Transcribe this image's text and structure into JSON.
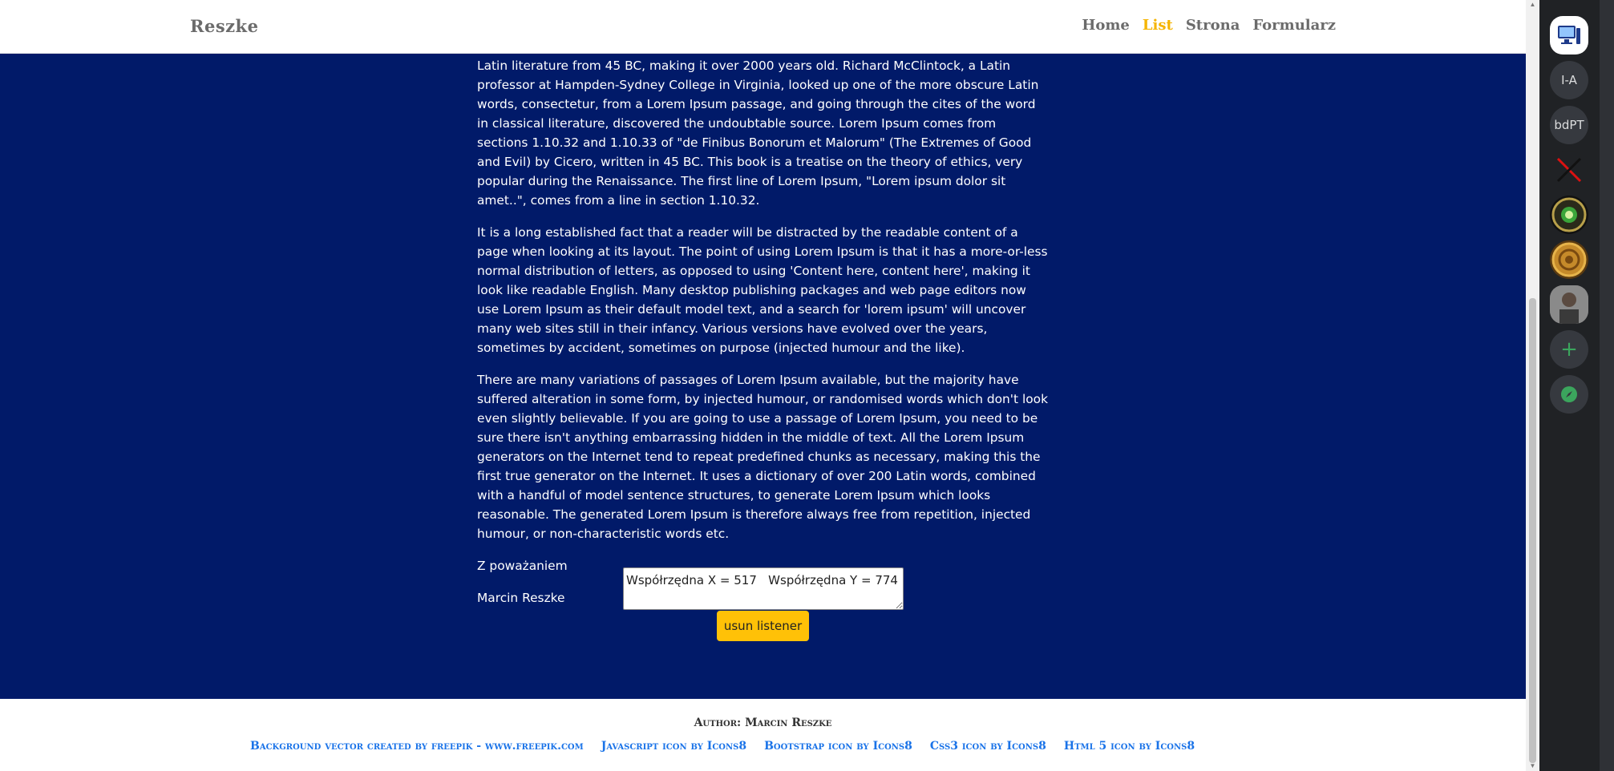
{
  "navbar": {
    "brand": "Reszke",
    "links": [
      {
        "label": "Home",
        "active": false
      },
      {
        "label": "List",
        "active": true
      },
      {
        "label": "Strona",
        "active": false
      },
      {
        "label": "Formularz",
        "active": false
      }
    ]
  },
  "content": {
    "paragraphs": [
      "Latin literature from 45 BC, making it over 2000 years old. Richard McClintock, a Latin professor at Hampden-Sydney College in Virginia, looked up one of the more obscure Latin words, consectetur, from a Lorem Ipsum passage, and going through the cites of the word in classical literature, discovered the undoubtable source. Lorem Ipsum comes from sections 1.10.32 and 1.10.33 of \"de Finibus Bonorum et Malorum\" (The Extremes of Good and Evil) by Cicero, written in 45 BC. This book is a treatise on the theory of ethics, very popular during the Renaissance. The first line of Lorem Ipsum, \"Lorem ipsum dolor sit amet..\", comes from a line in section 1.10.32.",
      "It is a long established fact that a reader will be distracted by the readable content of a page when looking at its layout. The point of using Lorem Ipsum is that it has a more-or-less normal distribution of letters, as opposed to using 'Content here, content here', making it look like readable English. Many desktop publishing packages and web page editors now use Lorem Ipsum as their default model text, and a search for 'lorem ipsum' will uncover many web sites still in their infancy. Various versions have evolved over the years, sometimes by accident, sometimes on purpose (injected humour and the like).",
      "There are many variations of passages of Lorem Ipsum available, but the majority have suffered alteration in some form, by injected humour, or randomised words which don't look even slightly believable. If you are going to use a passage of Lorem Ipsum, you need to be sure there isn't anything embarrassing hidden in the middle of text. All the Lorem Ipsum generators on the Internet tend to repeat predefined chunks as necessary, making this the first true generator on the Internet. It uses a dictionary of over 200 Latin words, combined with a handful of model sentence structures, to generate Lorem Ipsum which looks reasonable. The generated Lorem Ipsum is therefore always free from repetition, injected humour, or non-characteristic words etc."
    ],
    "closing": "Z poważaniem",
    "signature": "Marcin Reszke",
    "coords_value": "Współrzędna X = 517   Współrzędna Y = 774",
    "remove_button": "usun listener"
  },
  "footer": {
    "author": "Author: Marcin Reszke",
    "credits": [
      "Background vector created by freepik - www.freepik.com",
      "Javascript icon by Icons8",
      "Bootstrap icon by Icons8",
      "Css3 icon by Icons8",
      "Html 5 icon by Icons8"
    ]
  },
  "sidebar": {
    "items": [
      {
        "label": "",
        "icon": "computer-icon"
      },
      {
        "label": "I-A",
        "icon": ""
      },
      {
        "label": "bdPT",
        "icon": ""
      },
      {
        "label": "",
        "icon": "crossed-swords-icon"
      },
      {
        "label": "",
        "icon": "server-emblem-icon"
      },
      {
        "label": "",
        "icon": "ornament-icon"
      },
      {
        "label": "",
        "icon": "user-avatar-icon"
      },
      {
        "label": "+",
        "icon": "add-server-icon"
      },
      {
        "label": "",
        "icon": "compass-icon"
      }
    ]
  },
  "colors": {
    "main_bg": "#011a69",
    "accent": "#ffc107",
    "nav_active": "#f5b400",
    "link": "#1a73e8",
    "sidebar_bg": "#202225"
  }
}
